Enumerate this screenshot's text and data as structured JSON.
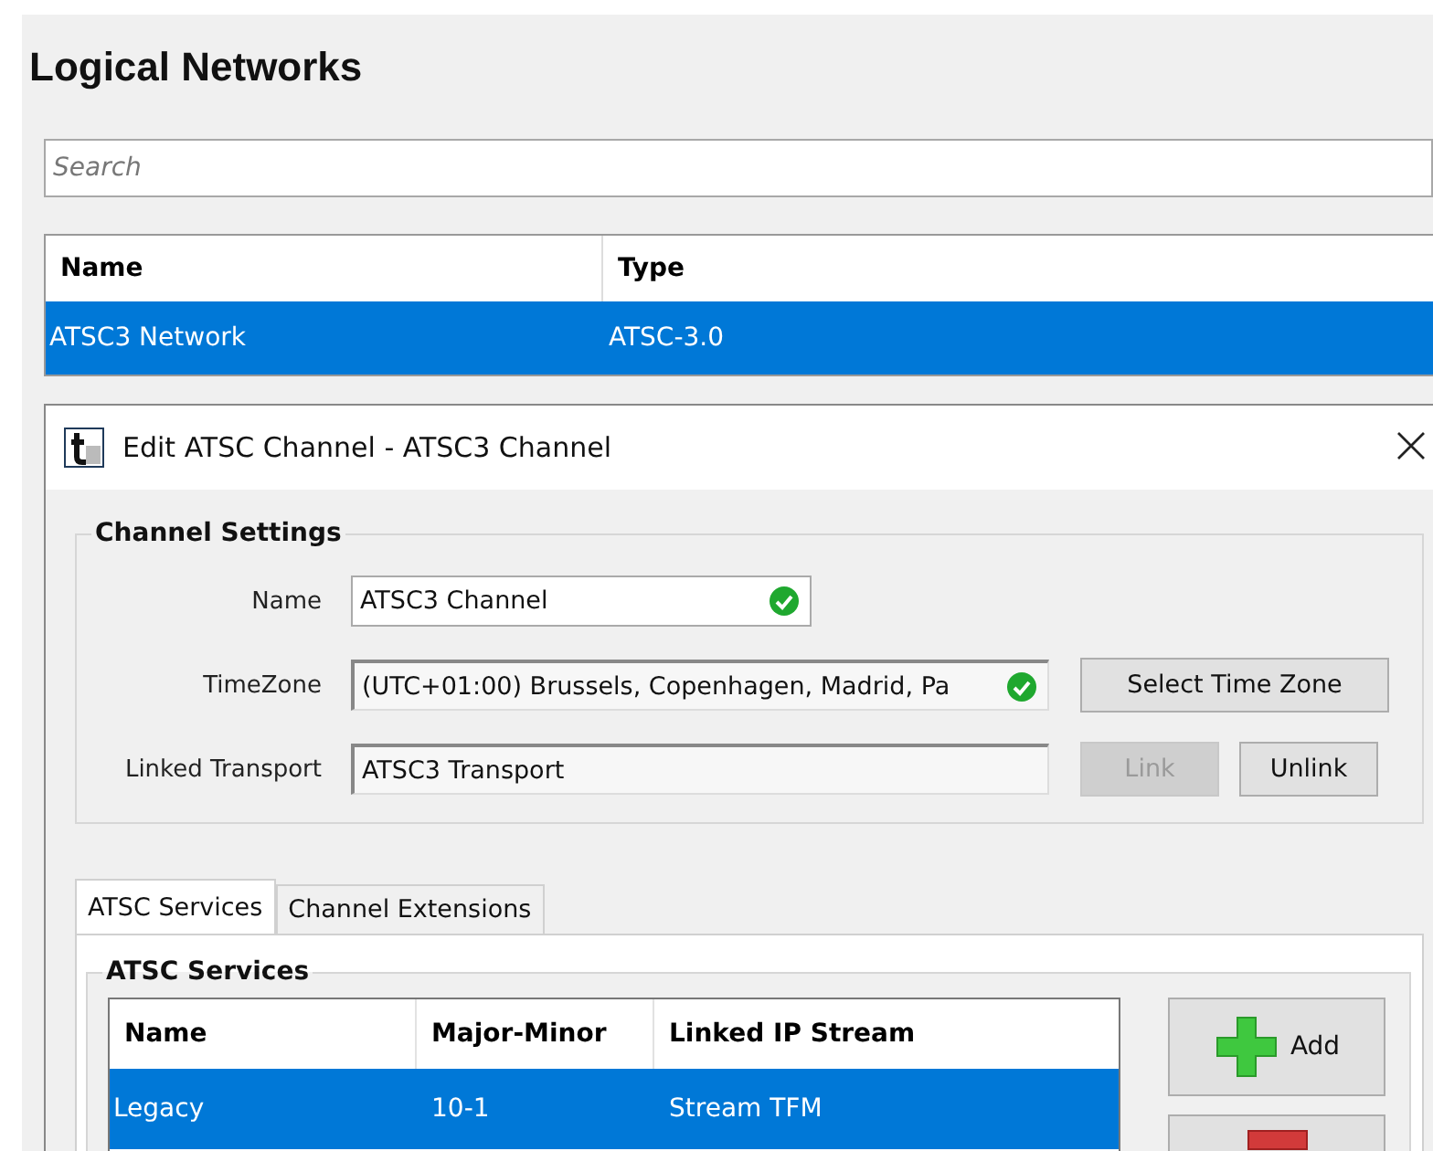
{
  "page": {
    "title": "Logical Networks"
  },
  "search": {
    "placeholder": "Search"
  },
  "networks": {
    "columns": [
      "Name",
      "Type"
    ],
    "rows": [
      {
        "cells": [
          "ATSC3 Network",
          "ATSC-3.0"
        ],
        "selected": true
      }
    ]
  },
  "dialog": {
    "title": "Edit ATSC Channel - ATSC3 Channel",
    "settings": {
      "title": "Channel Settings",
      "fields": [
        {
          "label": "Name",
          "value": "ATSC3 Channel",
          "valid": true,
          "readonly": false
        },
        {
          "label": "TimeZone",
          "value": "(UTC+01:00) Brussels, Copenhagen, Madrid, Pa",
          "valid": true,
          "readonly": true,
          "buttons": [
            {
              "label": "Select Time Zone",
              "disabled": false
            }
          ]
        },
        {
          "label": "Linked Transport",
          "value": "ATSC3 Transport",
          "valid": false,
          "readonly": true,
          "buttons": [
            {
              "label": "Link",
              "disabled": true
            },
            {
              "label": "Unlink",
              "disabled": false
            }
          ]
        }
      ]
    },
    "tabs": [
      {
        "label": "ATSC Services",
        "selected": true
      },
      {
        "label": "Channel Extensions",
        "selected": false
      }
    ],
    "services": {
      "title": "ATSC Services",
      "columns": [
        "Name",
        "Major-Minor",
        "Linked IP Stream"
      ],
      "rows": [
        {
          "cells": [
            "Legacy",
            "10-1",
            "Stream TFM"
          ],
          "selected": true
        }
      ],
      "buttons": [
        {
          "label": "Add",
          "kind": "add"
        },
        {
          "kind": "remove"
        }
      ]
    }
  }
}
